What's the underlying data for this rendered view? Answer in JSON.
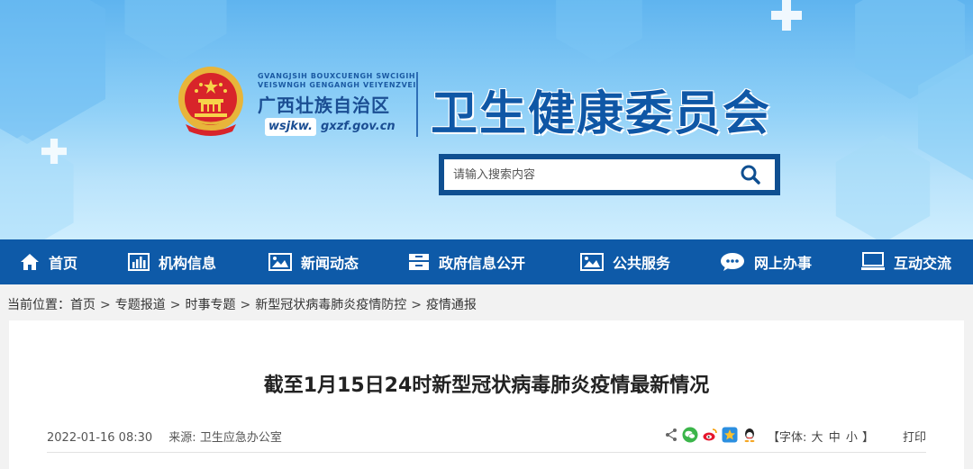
{
  "header": {
    "pinyin_line1": "GVANGJSIH BOUXCUENGH SWCIGIH",
    "pinyin_line2": "VEISWNGH GENGANGH VEIYENZVEI",
    "region_name": "广西壮族自治区",
    "domain_prefix": "wsjkw.",
    "domain_rest": "gxzf.gov.cn",
    "commission_name": "卫生健康委员会"
  },
  "search": {
    "placeholder": "请输入搜索内容",
    "icon": "search-icon"
  },
  "nav": {
    "items": [
      {
        "label": "首页",
        "icon": "home-icon"
      },
      {
        "label": "机构信息",
        "icon": "bar-chart-icon"
      },
      {
        "label": "新闻动态",
        "icon": "image-icon"
      },
      {
        "label": "政府信息公开",
        "icon": "cabinet-icon"
      },
      {
        "label": "公共服务",
        "icon": "picture-icon"
      },
      {
        "label": "网上办事",
        "icon": "chat-bubble-icon"
      },
      {
        "label": "互动交流",
        "icon": "monitor-icon"
      }
    ]
  },
  "breadcrumb": {
    "prefix": "当前位置：",
    "items": [
      "首页",
      "专题报道",
      "时事专题",
      "新型冠状病毒肺炎疫情防控",
      "疫情通报"
    ],
    "separator": ">"
  },
  "article": {
    "title": "截至1月15日24时新型冠状病毒肺炎疫情最新情况",
    "date": "2022-01-16 08:30",
    "source_label": "来源:",
    "source": "卫生应急办公室",
    "share_icons": [
      "share-icon",
      "wechat-icon",
      "weibo-icon",
      "qzone-icon",
      "qq-icon"
    ],
    "font_size_open": "【字体:",
    "font_large": "大",
    "font_medium": "中",
    "font_small": "小",
    "font_size_close": "】",
    "print_label": "打印"
  },
  "colors": {
    "nav_bg": "#0e5aa8",
    "title_blue": "#0f57a6",
    "search_frame": "#0f4f91"
  }
}
